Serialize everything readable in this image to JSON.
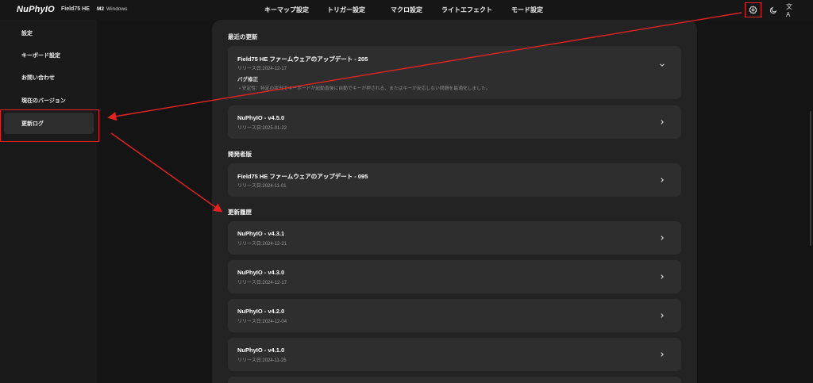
{
  "app": {
    "logo": "NuPhyIO",
    "device": "Field75 HE",
    "os_badge": "M2",
    "os_name": "Windows"
  },
  "nav": {
    "items": [
      "キーマップ設定",
      "トリガー設定",
      "マクロ設定",
      "ライトエフェクト",
      "モード設定"
    ]
  },
  "top_icons": [
    "settings-gear-icon",
    "moon-dark-mode-icon",
    "language-icon"
  ],
  "lang_glyph": "文A",
  "sidebar": {
    "items": [
      {
        "label": "設定"
      },
      {
        "label": "キーボード設定"
      },
      {
        "label": "お問い合わせ"
      },
      {
        "label": "現在のバージョン"
      },
      {
        "label": "更新ログ",
        "active": true
      }
    ]
  },
  "sections": {
    "recent": "最近の更新",
    "developer": "開発者版",
    "history": "更新履歴"
  },
  "recent_cards": [
    {
      "title": "Field75 HE ファームウェアのアップデート - 205",
      "date": "リリース日:2024-12-17",
      "expanded": true,
      "notes_heading": "バグ修正",
      "notes": [
        "• 安定性：特定の状況でキーボードが起動直後に自動でキーが押される、またはキーが反応しない問題を最適化しました。"
      ]
    },
    {
      "title": "NuPhyIO - v4.5.0",
      "date": "リリース日:2025-01-22"
    }
  ],
  "developer_cards": [
    {
      "title": "Field75 HE ファームウェアのアップデート - 095",
      "date": "リリース日:2024-11-01"
    }
  ],
  "history_cards": [
    {
      "title": "NuPhyIO - v4.3.1",
      "date": "リリース日:2024-12-21"
    },
    {
      "title": "NuPhyIO - v4.3.0",
      "date": "リリース日:2024-12-17"
    },
    {
      "title": "NuPhyIO - v4.2.0",
      "date": "リリース日:2024-12-04"
    },
    {
      "title": "NuPhyIO - v4.1.0",
      "date": "リリース日:2024-11-25"
    }
  ],
  "colors": {
    "annotation": "#e52222",
    "background": "#141414",
    "card": "#2e2e2e"
  }
}
